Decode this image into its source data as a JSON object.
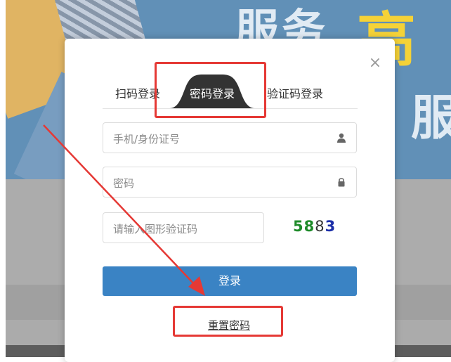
{
  "background": {
    "banner_text_1": "服务",
    "banner_text_2": "高",
    "banner_text_3": "服"
  },
  "modal": {
    "close_symbol": "×",
    "tabs": [
      {
        "label": "扫码登录",
        "active": false
      },
      {
        "label": "密码登录",
        "active": true
      },
      {
        "label": "验证码登录",
        "active": false
      }
    ],
    "phone_placeholder": "手机/身份证号",
    "password_placeholder": "密码",
    "captcha_placeholder": "请输入图形验证码",
    "captcha_chars": [
      "5",
      "8",
      "8",
      "3"
    ],
    "login_label": "登录",
    "reset_label": "重置密码"
  },
  "icons": {
    "phone_field": "user-icon",
    "password_field": "lock-icon",
    "close": "close-icon"
  },
  "colors": {
    "primary_button": "#3a83c4",
    "active_tab": "#333333",
    "annotation": "#e53935",
    "captcha_green": "#1f8b2a",
    "captcha_blue": "#1c2fa8"
  }
}
